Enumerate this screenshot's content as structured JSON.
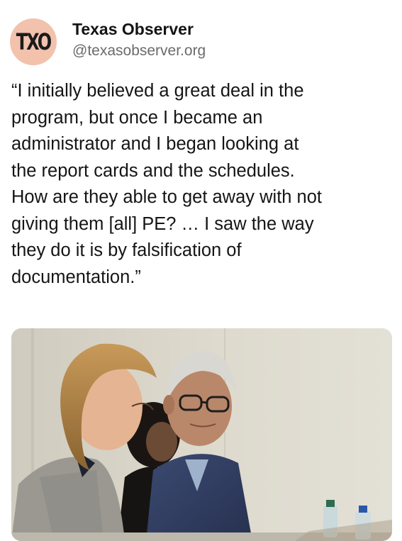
{
  "account": {
    "avatar_text": "TXO",
    "display_name": "Texas Observer",
    "handle": "@texasobserver.org"
  },
  "post": {
    "text": "“I initially believed a great deal in the\nprogram, but once I became an\nadministrator and I began looking at\nthe report cards and the schedules.\nHow are they able to get away with not\ngiving them [all] PE? … I saw the way\nthey do it is by falsification of\ndocumentation.”"
  },
  "media": {
    "description_icon": "photo-of-meeting-attendees"
  },
  "colors": {
    "avatar_bg": "#f2c2ad",
    "handle_gray": "#6b6b6b"
  }
}
